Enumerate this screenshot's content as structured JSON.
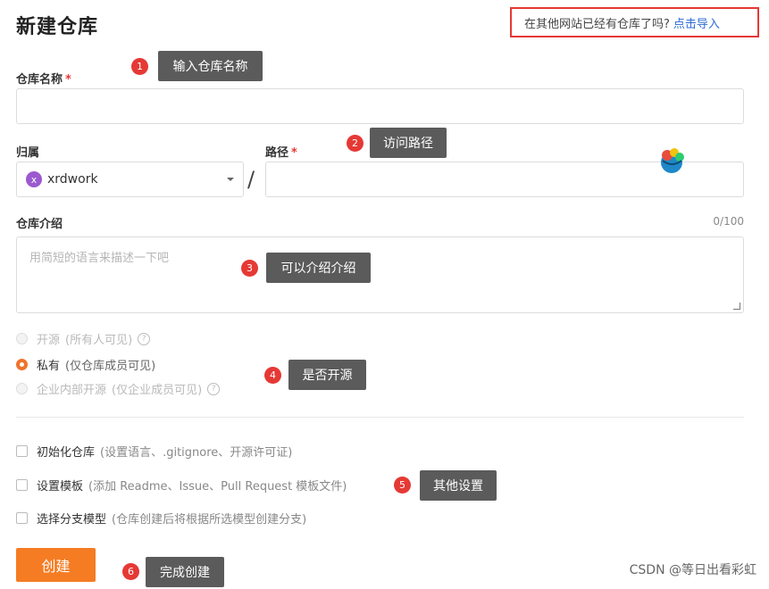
{
  "header": {
    "title": "新建仓库",
    "import_prompt": "在其他网站已经有仓库了吗?",
    "import_link": "点击导入"
  },
  "form": {
    "repo_name_label": "仓库名称",
    "required_mark": "*",
    "owner_label": "归属",
    "owner_avatar": "x",
    "owner_value": "xrdwork",
    "path_separator": "/",
    "path_label": "路径",
    "desc_label": "仓库介绍",
    "desc_counter": "0/100",
    "desc_placeholder": "用简短的语言来描述一下吧"
  },
  "visibility": {
    "options": [
      {
        "label": "开源",
        "hint": "(所有人可见)",
        "selected": false,
        "disabled": true
      },
      {
        "label": "私有",
        "hint": "(仅仓库成员可见)",
        "selected": true,
        "disabled": false
      },
      {
        "label": "企业内部开源",
        "hint": "(仅企业成员可见)",
        "selected": false,
        "disabled": true
      }
    ],
    "help_glyph": "?"
  },
  "settings": {
    "options": [
      {
        "label": "初始化仓库",
        "hint": "(设置语言、.gitignore、开源许可证)",
        "checked": false
      },
      {
        "label": "设置模板",
        "hint": "(添加 Readme、Issue、Pull Request 模板文件)",
        "checked": false
      },
      {
        "label": "选择分支模型",
        "hint": "(仓库创建后将根据所选模型创建分支)",
        "checked": false
      }
    ]
  },
  "create_button": "创建",
  "annotations": [
    {
      "number": "1",
      "text": "输入仓库名称"
    },
    {
      "number": "2",
      "text": "访问路径"
    },
    {
      "number": "3",
      "text": "可以介绍介绍"
    },
    {
      "number": "4",
      "text": "是否开源"
    },
    {
      "number": "5",
      "text": "其他设置"
    },
    {
      "number": "6",
      "text": "完成创建"
    }
  ],
  "watermark": "CSDN @等日出看彩虹",
  "colors": {
    "accent": "#f57c23",
    "link": "#2e6bd6",
    "required": "#e53935",
    "annotation_badge": "#e53935",
    "annotation_tip": "#5b5b5b",
    "avatar": "#9b59d0"
  },
  "icons": {
    "mascot": "mascot-icon",
    "help": "help-circle-icon",
    "dropdown": "chevron-down-icon"
  }
}
